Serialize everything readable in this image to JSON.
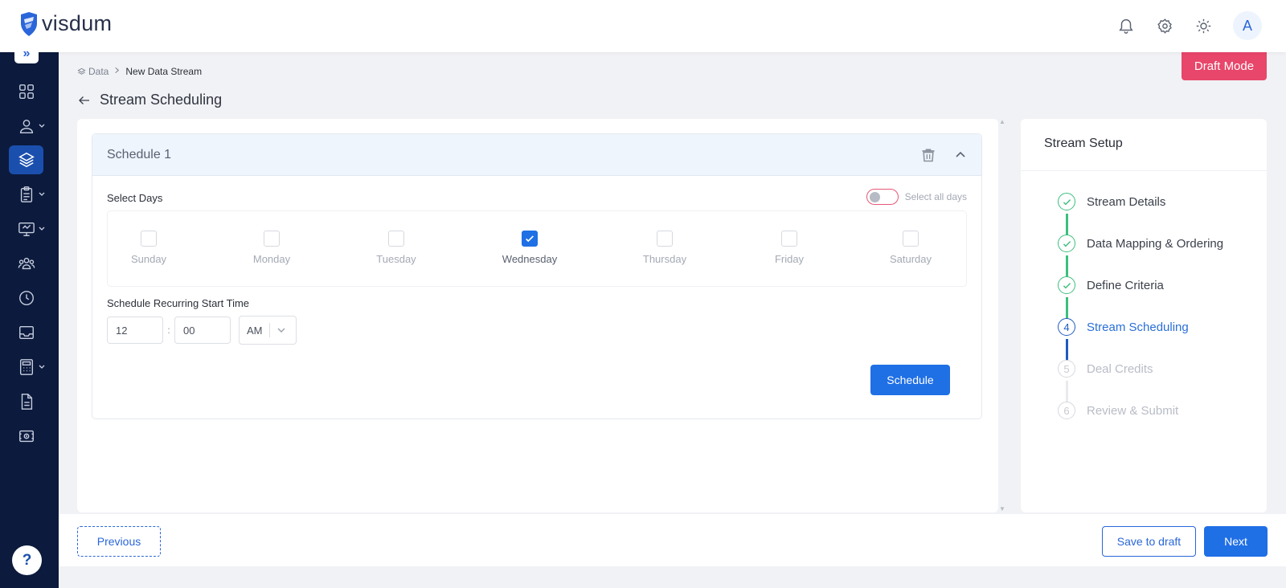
{
  "app": {
    "logo_text": "visdum",
    "avatar_initial": "A"
  },
  "breadcrumb": {
    "root": "Data",
    "current": "New Data Stream"
  },
  "page": {
    "title": "Stream Scheduling",
    "mode_badge": "Draft Mode"
  },
  "schedule": {
    "title": "Schedule 1",
    "select_days_label": "Select Days",
    "select_all_label": "Select all days",
    "select_all_enabled": false,
    "days": [
      {
        "label": "Sunday",
        "checked": false
      },
      {
        "label": "Monday",
        "checked": false
      },
      {
        "label": "Tuesday",
        "checked": false
      },
      {
        "label": "Wednesday",
        "checked": true
      },
      {
        "label": "Thursday",
        "checked": false
      },
      {
        "label": "Friday",
        "checked": false
      },
      {
        "label": "Saturday",
        "checked": false
      }
    ],
    "time_label": "Schedule Recurring Start Time",
    "hour": "12",
    "separator": ":",
    "minute": "00",
    "period": "AM",
    "submit_label": "Schedule"
  },
  "setup": {
    "title": "Stream Setup",
    "steps": [
      {
        "number": "1",
        "label": "Stream Details",
        "state": "done"
      },
      {
        "number": "2",
        "label": "Data Mapping & Ordering",
        "state": "done"
      },
      {
        "number": "3",
        "label": "Define Criteria",
        "state": "done"
      },
      {
        "number": "4",
        "label": "Stream Scheduling",
        "state": "current"
      },
      {
        "number": "5",
        "label": "Deal Credits",
        "state": "todo"
      },
      {
        "number": "6",
        "label": "Review & Submit",
        "state": "todo"
      }
    ]
  },
  "footer": {
    "previous_label": "Previous",
    "save_draft_label": "Save to draft",
    "next_label": "Next"
  },
  "help_label": "?",
  "colors": {
    "primary": "#1f6fe5",
    "sidebar": "#0c1a3d",
    "draft_badge": "#e8466a",
    "step_done": "#3cbf7d"
  },
  "icons": {
    "sidebar": [
      "dashboard-icon",
      "user-icon",
      "layers-icon",
      "clipboard-icon",
      "monitor-icon",
      "team-icon",
      "clock-icon",
      "inbox-icon",
      "calculator-icon",
      "document-icon",
      "money-icon"
    ],
    "topbar": [
      "bell-icon",
      "gear-icon",
      "sun-icon"
    ]
  }
}
